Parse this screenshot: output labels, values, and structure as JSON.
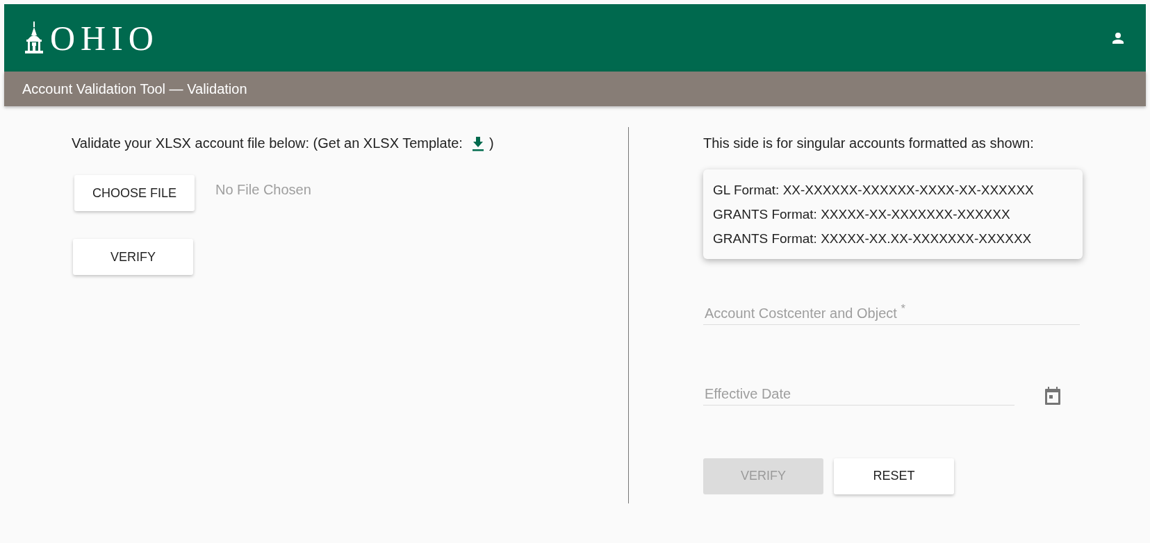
{
  "header": {
    "logo_text": "OHIO"
  },
  "title_bar": {
    "title": "Account Validation Tool — Validation"
  },
  "file_panel": {
    "instruction": "Validate your XLSX account file below: (Get an XLSX Template:",
    "instruction_end": ")",
    "choose_button": {
      "label": "CHOOSE FILE",
      "disabled": false
    },
    "file_status": "No File Chosen",
    "verify_button": {
      "label": "VERIFY",
      "disabled": false
    }
  },
  "account_panel": {
    "intro": "This side is for singular accounts formatted as shown:",
    "formats": [
      "GL Format: XX-XXXXXX-XXXXXX-XXXX-XX-XXXXXX",
      "GRANTS Format: XXXXX-XX-XXXXXXX-XXXXXX",
      "GRANTS Format: XXXXX-XX.XX-XXXXXXX-XXXXXX"
    ],
    "account_field": {
      "placeholder": "Account Costcenter and Object $^{*}$"
    },
    "date_field": {
      "placeholder": "Effective Date"
    },
    "buttons": [
      {
        "label": "VERIFY",
        "disabled": true
      },
      {
        "label": "RESET",
        "disabled": false
      }
    ]
  }
}
